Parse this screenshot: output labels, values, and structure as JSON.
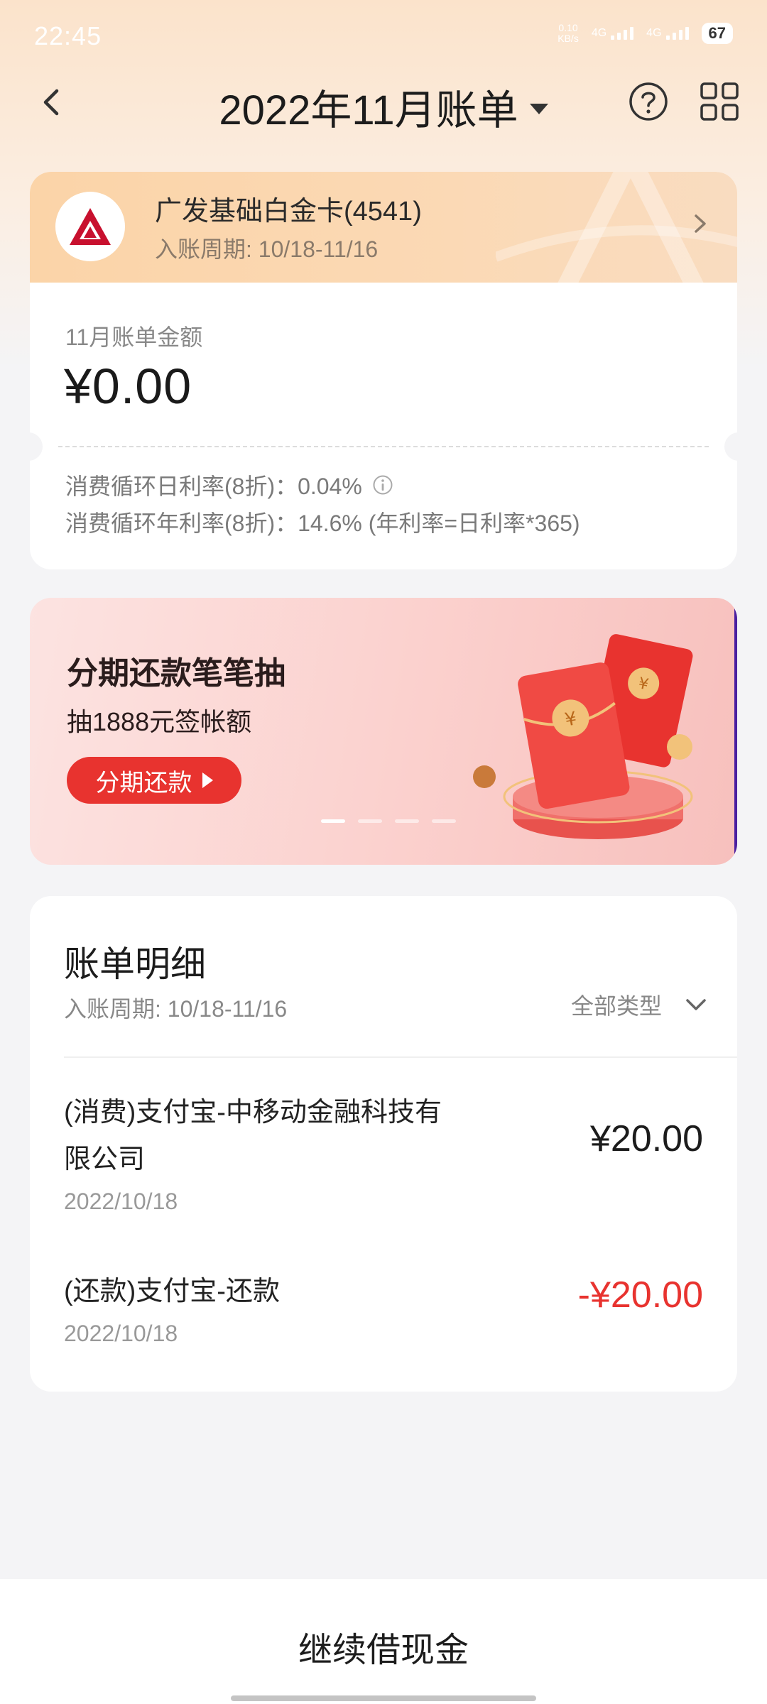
{
  "status_bar": {
    "time": "22:45",
    "net_speed_value": "0.10",
    "net_speed_unit": "KB/s",
    "signal1_label": "4G",
    "signal2_label": "4G",
    "battery": "67"
  },
  "nav": {
    "title": "2022年11月账单",
    "back_icon": "chevron-left-icon",
    "help_icon": "question-circle-icon",
    "grid_icon": "grid-icon"
  },
  "card": {
    "name": "广发基础白金卡(4541)",
    "period": "入账周期: 10/18-11/16",
    "amount_label": "11月账单金额",
    "amount_value": "¥0.00",
    "daily_rate": "消费循环日利率(8折)：0.04%",
    "annual_rate": "消费循环年利率(8折)：14.6% (年利率=日利率*365)",
    "brand_color": "#c8102e"
  },
  "banner": {
    "title": "分期还款笔笔抽",
    "subtitle": "抽1888元签帐额",
    "button_label": "分期还款",
    "slide_count": 4,
    "active_slide": 1
  },
  "detail": {
    "title": "账单明细",
    "period": "入账周期: 10/18-11/16",
    "filter_label": "全部类型",
    "rows": [
      {
        "desc": "(消费)支付宝-中移动金融科技有限公司",
        "date": "2022/10/18",
        "amount": "¥20.00"
      },
      {
        "desc": "(还款)支付宝-还款",
        "date": "2022/10/18",
        "amount": "-¥20.00"
      }
    ]
  },
  "bottom": {
    "button_label": "继续借现金"
  },
  "colors": {
    "accent_red": "#e8332f",
    "header_gradient_start": "#fbe3cb"
  }
}
